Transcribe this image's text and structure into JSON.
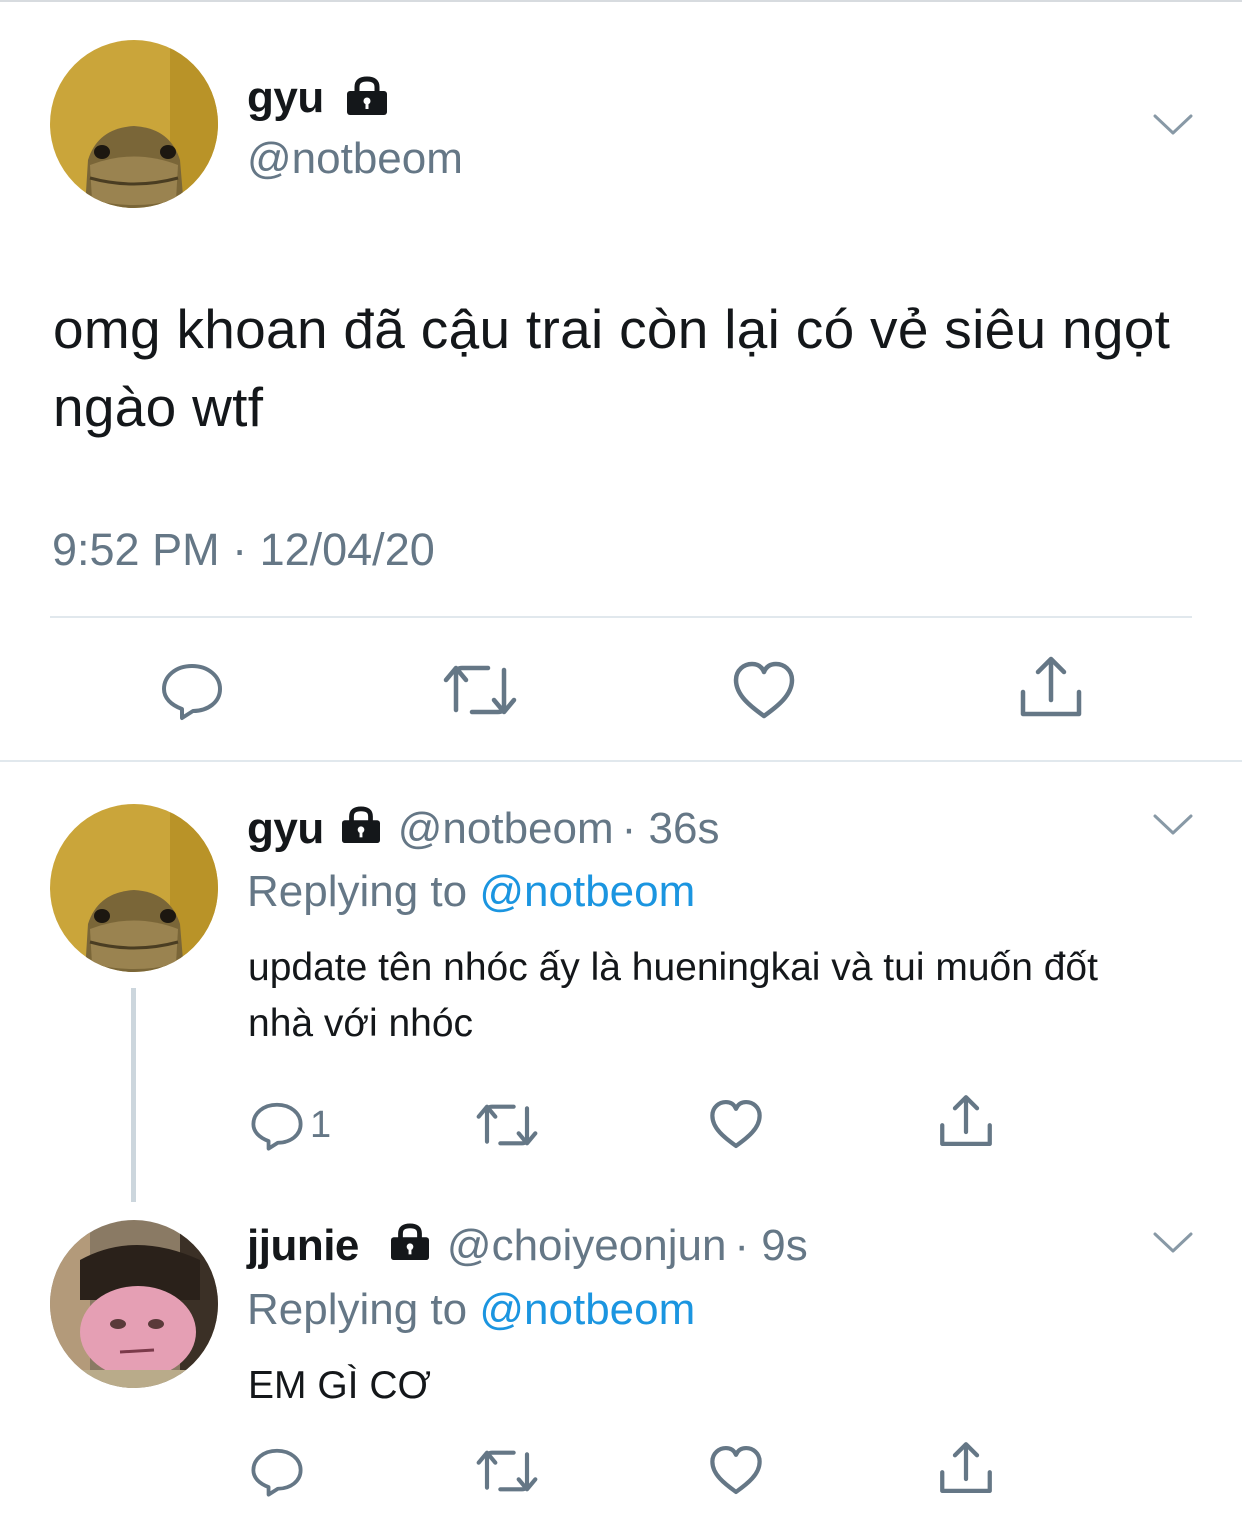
{
  "main_tweet": {
    "display_name": "gyu",
    "handle": "@notbeom",
    "text": "omg khoan đã cậu trai còn lại có vẻ siêu ngọt ngào wtf",
    "timestamp": "9:52 PM · 12/04/20",
    "avatar_icon": "lizard-avatar",
    "actions": [
      "reply-icon",
      "retweet-icon",
      "like-icon",
      "share-icon"
    ]
  },
  "replies": [
    {
      "display_name": "gyu",
      "handle": "@notbeom",
      "time": "· 36s",
      "replying_prefix": "Replying to",
      "replying_to": "@notbeom",
      "text": "update tên nhóc ấy là hueningkai và tui muốn đốt nhà với nhóc",
      "reply_count": "1",
      "avatar_icon": "lizard-avatar"
    },
    {
      "display_name": "jjunie",
      "handle": "@choiyeonjun",
      "time": "· 9s",
      "replying_prefix": "Replying to",
      "replying_to": "@notbeom",
      "text": "EM GÌ CƠ",
      "reply_count": "",
      "avatar_icon": "kirby-avatar"
    }
  ],
  "colors": {
    "text": "#14171a",
    "secondary": "#657786",
    "link": "#1b95e0",
    "divider": "#e1e8ed"
  }
}
